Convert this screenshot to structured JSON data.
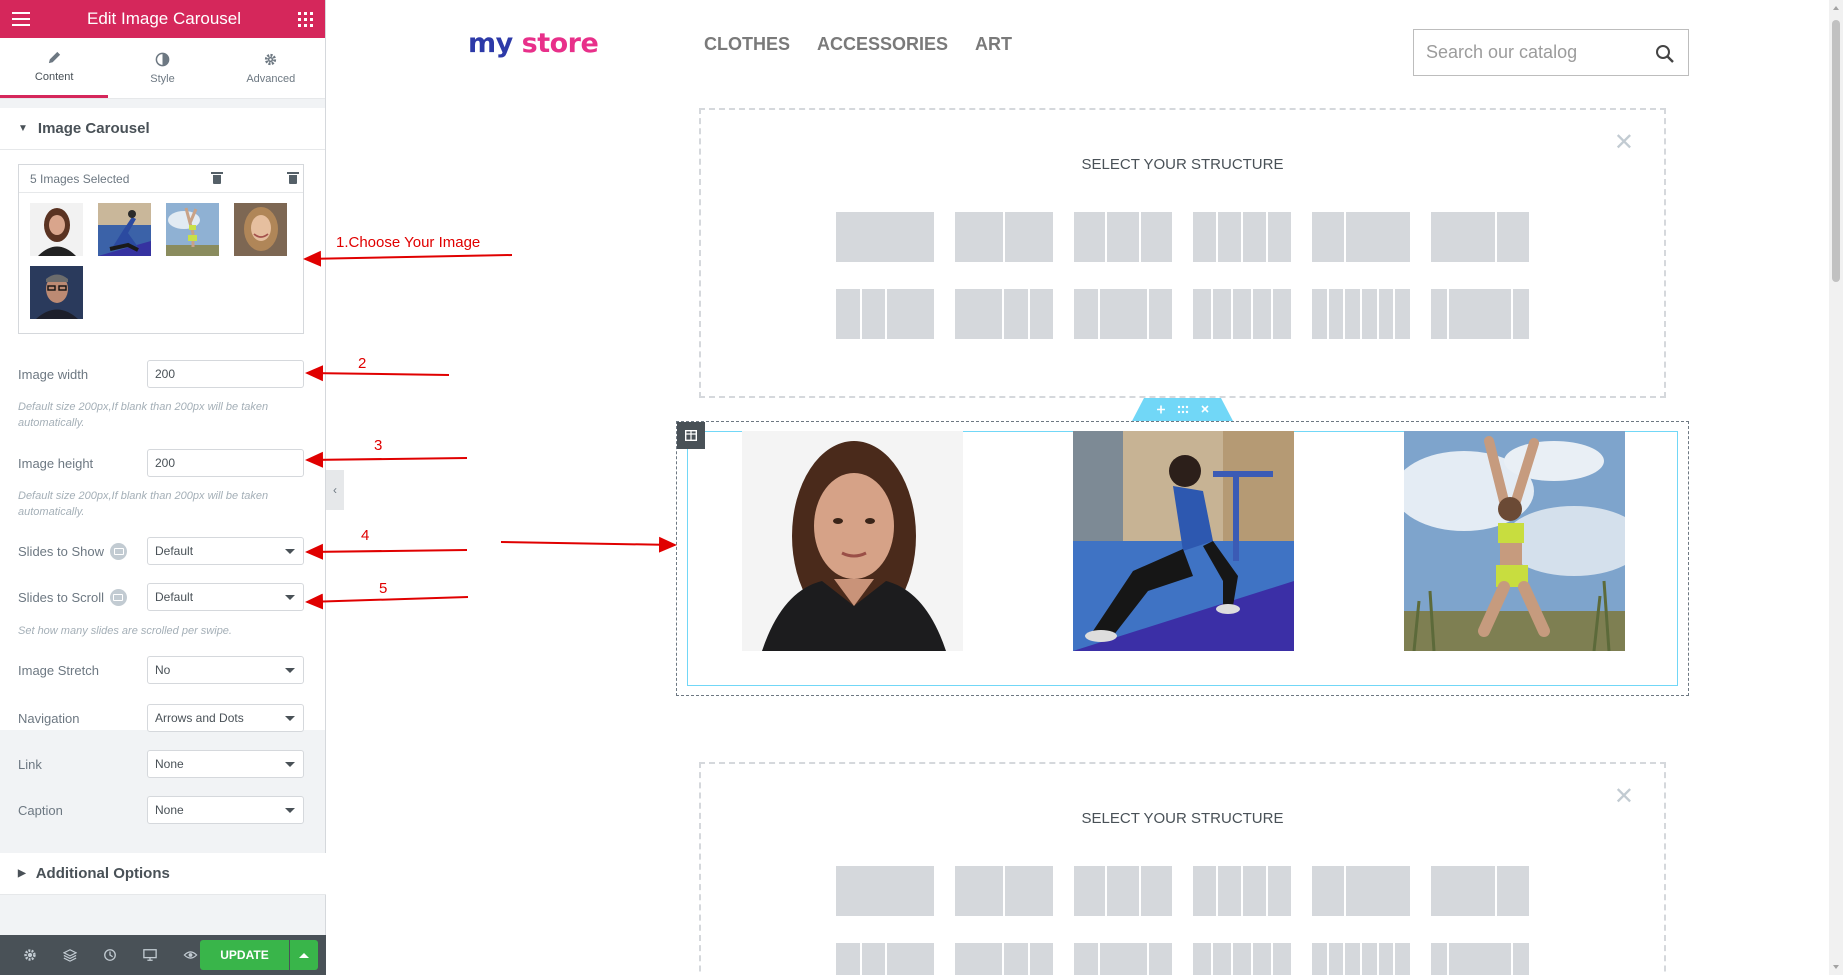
{
  "panel": {
    "title": "Edit Image Carousel",
    "tabs": [
      {
        "label": "Content",
        "icon": "pencil-icon"
      },
      {
        "label": "Style",
        "icon": "half-circle-icon"
      },
      {
        "label": "Advanced",
        "icon": "gear-icon"
      }
    ],
    "section_title": "Image Carousel",
    "gallery": {
      "count_label": "5 Images Selected",
      "images": [
        "woman-portrait",
        "woman-exercise-mat",
        "woman-stretch-sky",
        "woman-smiling",
        "man-glasses"
      ]
    },
    "image_width": {
      "label": "Image width",
      "value": "200",
      "help": "Default size 200px,If blank than 200px will be taken automatically."
    },
    "image_height": {
      "label": "Image height",
      "value": "200",
      "help": "Default size 200px,If blank than 200px will be taken automatically."
    },
    "slides_to_show": {
      "label": "Slides to Show",
      "value": "Default"
    },
    "slides_to_scroll": {
      "label": "Slides to Scroll",
      "value": "Default",
      "help": "Set how many slides are scrolled per swipe."
    },
    "image_stretch": {
      "label": "Image Stretch",
      "value": "No"
    },
    "navigation": {
      "label": "Navigation",
      "value": "Arrows and Dots"
    },
    "link": {
      "label": "Link",
      "value": "None"
    },
    "caption": {
      "label": "Caption",
      "value": "None"
    },
    "additional_title": "Additional Options",
    "update_label": "UPDATE"
  },
  "store": {
    "logo_my": "my",
    "logo_store": "store",
    "nav": [
      "CLOTHES",
      "ACCESSORIES",
      "ART"
    ],
    "search_placeholder": "Search our catalog",
    "structure_title": "SELECT YOUR STRUCTURE",
    "close_glyph": "✕"
  },
  "annotations": [
    "1.Choose Your Image",
    "2",
    "3",
    "4",
    "5"
  ],
  "colors": {
    "brand": "#d5275b",
    "update": "#39b54a",
    "annotation": "#e00000",
    "selection": "#71d7f7"
  }
}
